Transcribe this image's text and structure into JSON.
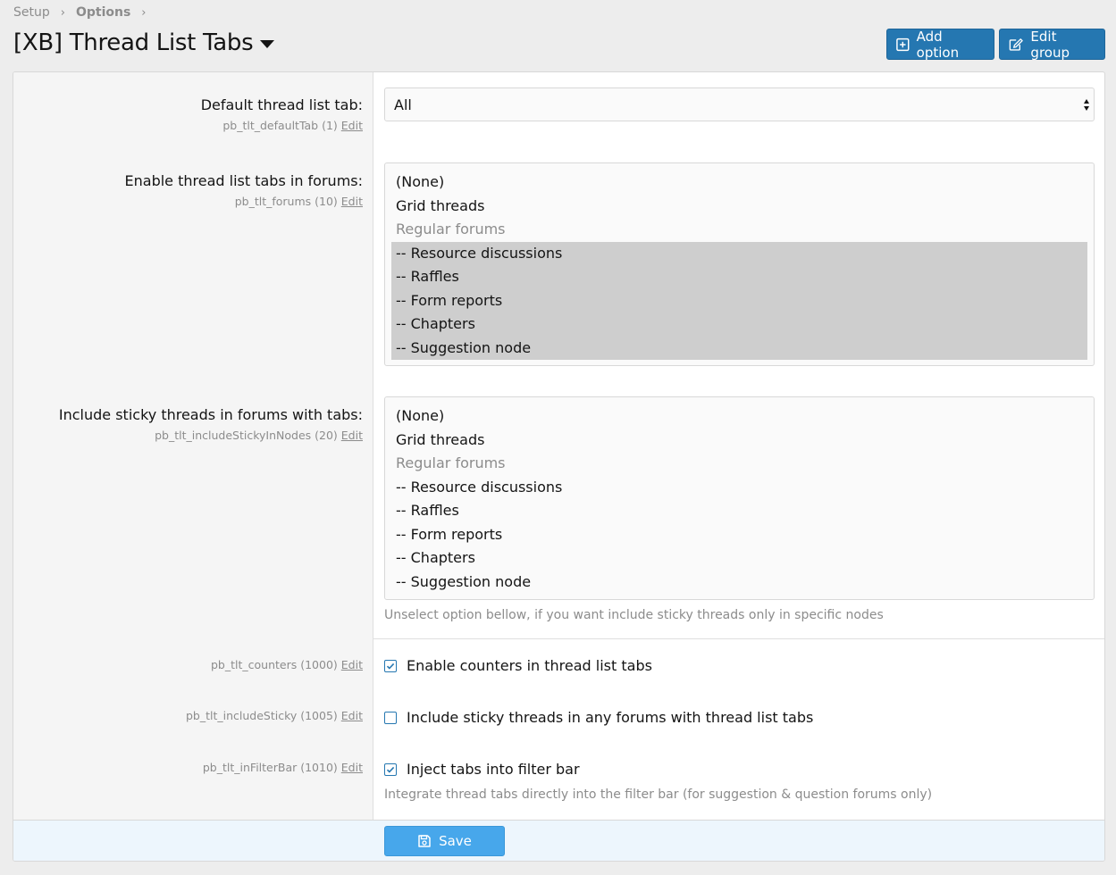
{
  "breadcrumb": {
    "items": [
      "Setup",
      "Options"
    ]
  },
  "page_title": "[XB] Thread List Tabs",
  "header_buttons": {
    "add_option": "Add option",
    "edit_group": "Edit group"
  },
  "options": {
    "default_tab": {
      "label": "Default thread list tab:",
      "meta": "pb_tlt_defaultTab (1)",
      "edit": "Edit",
      "value": "All"
    },
    "forums": {
      "label": "Enable thread list tabs in forums:",
      "meta": "pb_tlt_forums (10)",
      "edit": "Edit",
      "items": [
        "(None)",
        "Grid threads",
        "Regular forums",
        "-- Resource discussions",
        "-- Raffles",
        "-- Form reports",
        "-- Chapters",
        "-- Suggestion node"
      ]
    },
    "sticky_nodes": {
      "label": "Include sticky threads in forums with tabs:",
      "meta": "pb_tlt_includeStickyInNodes (20)",
      "edit": "Edit",
      "items": [
        "(None)",
        "Grid threads",
        "Regular forums",
        "-- Resource discussions",
        "-- Raffles",
        "-- Form reports",
        "-- Chapters",
        "-- Suggestion node"
      ],
      "hint": "Unselect option bellow, if you want include sticky threads only in specific nodes"
    },
    "counters": {
      "meta": "pb_tlt_counters (1000)",
      "edit": "Edit",
      "label": "Enable counters in thread list tabs",
      "checked": true
    },
    "include_sticky": {
      "meta": "pb_tlt_includeSticky (1005)",
      "edit": "Edit",
      "label": "Include sticky threads in any forums with thread list tabs",
      "checked": false
    },
    "in_filter_bar": {
      "meta": "pb_tlt_inFilterBar (1010)",
      "edit": "Edit",
      "label": "Inject tabs into filter bar",
      "checked": true,
      "hint": "Integrate thread tabs directly into the filter bar (for suggestion & question forums only)"
    }
  },
  "save_label": "Save",
  "colors": {
    "primary": "#2577b1",
    "save": "#47a7eb",
    "footer_bg": "#edf6fd",
    "selected": "#cecece"
  }
}
